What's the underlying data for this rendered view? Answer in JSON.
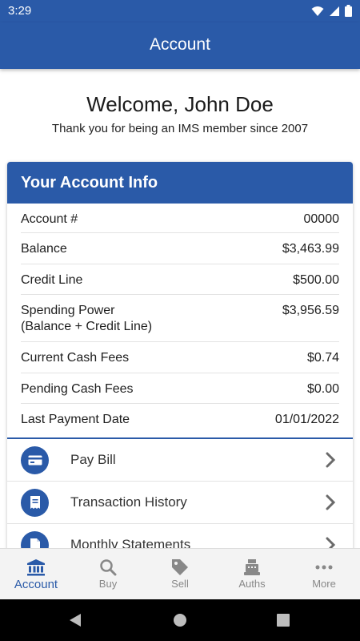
{
  "status": {
    "time": "3:29"
  },
  "header": {
    "title": "Account"
  },
  "welcome": {
    "greeting": "Welcome, John Doe",
    "member_since": "Thank you for being an IMS member since 2007"
  },
  "account_info": {
    "title": "Your Account Info",
    "rows": [
      {
        "label": "Account #",
        "value": "00000"
      },
      {
        "label": "Balance",
        "value": "$3,463.99"
      },
      {
        "label": "Credit Line",
        "value": "$500.00"
      },
      {
        "label": "Spending Power",
        "sublabel": "(Balance + Credit Line)",
        "value": "$3,956.59"
      },
      {
        "label": "Current Cash Fees",
        "value": "$0.74"
      },
      {
        "label": "Pending Cash Fees",
        "value": "$0.00"
      },
      {
        "label": "Last Payment Date",
        "value": "01/01/2022"
      }
    ]
  },
  "actions": [
    {
      "label": "Pay Bill",
      "icon": "credit-card-icon"
    },
    {
      "label": "Transaction History",
      "icon": "receipt-icon"
    },
    {
      "label": "Monthly Statements",
      "icon": "document-icon"
    }
  ],
  "bottom_nav": [
    {
      "label": "Account",
      "icon": "bank-icon",
      "active": true
    },
    {
      "label": "Buy",
      "icon": "search-icon",
      "active": false
    },
    {
      "label": "Sell",
      "icon": "tag-icon",
      "active": false
    },
    {
      "label": "Auths",
      "icon": "cash-register-icon",
      "active": false
    },
    {
      "label": "More",
      "icon": "more-dots-icon",
      "active": false
    }
  ],
  "colors": {
    "primary": "#2a5aa8",
    "nav_inactive": "#888888"
  }
}
